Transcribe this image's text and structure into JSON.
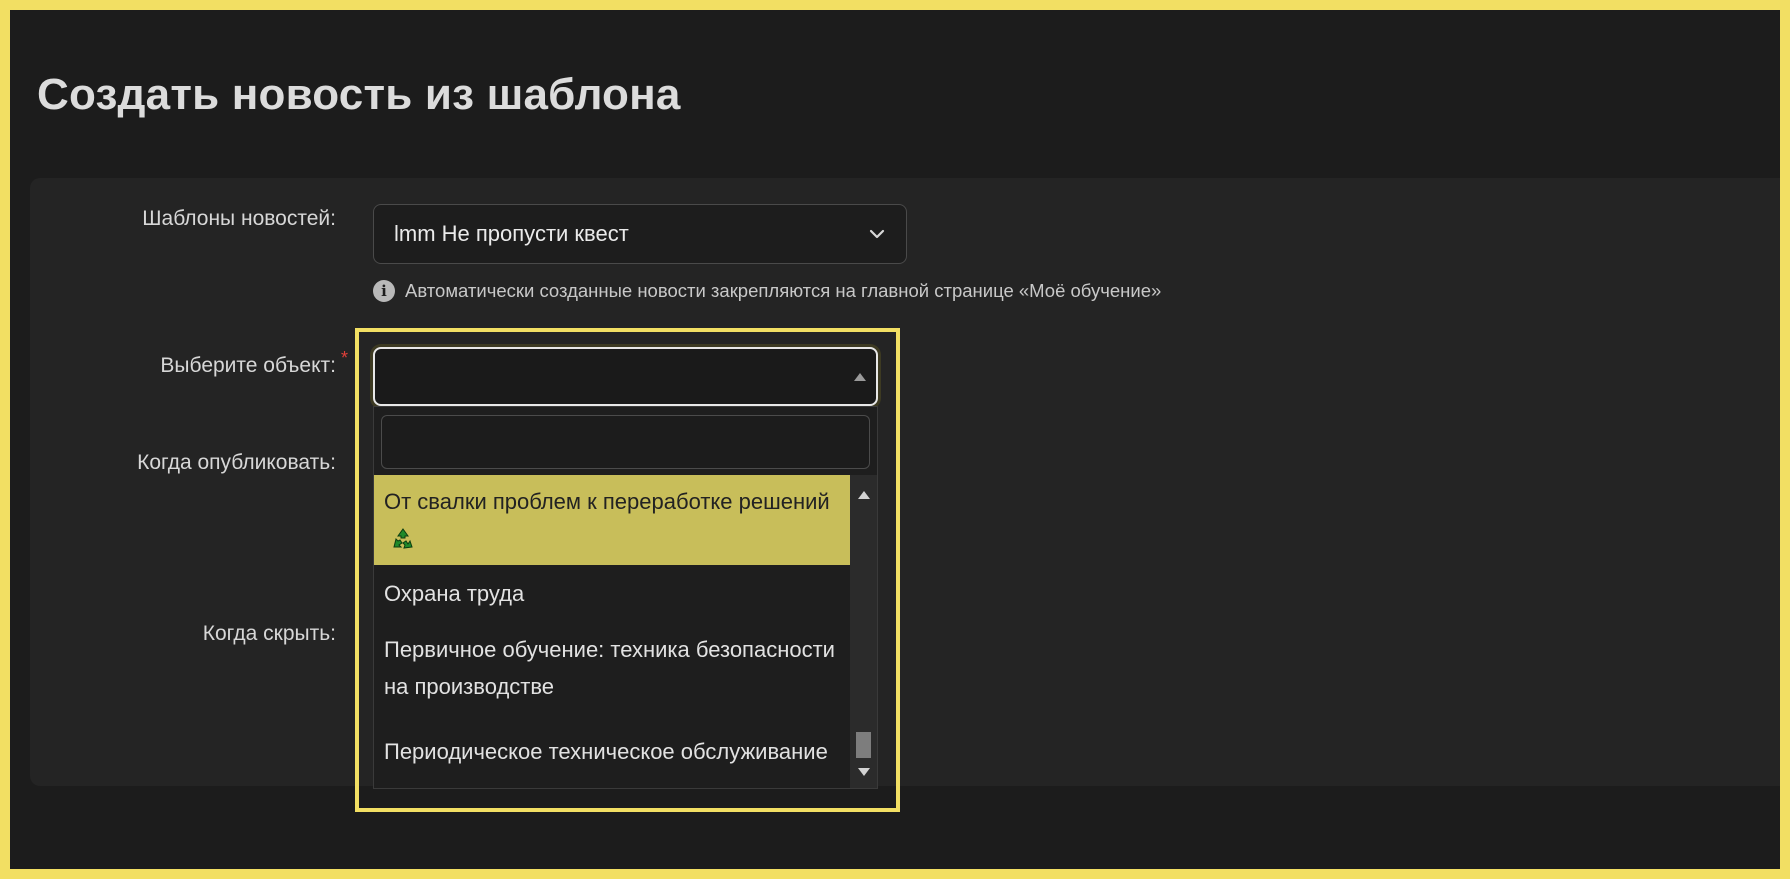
{
  "page": {
    "title": "Создать новость из шаблона"
  },
  "form": {
    "templates_label": "Шаблоны новостей:",
    "templates_value": "lmm Не пропусти квест",
    "hint": "Автоматически созданные новости закрепляются на главной странице «Моё обучение»",
    "object_label": "Выберите объект:",
    "object_required_mark": "*",
    "publish_label": "Когда опубликовать:",
    "hide_label": "Когда скрыть:"
  },
  "dropdown": {
    "search_value": "",
    "items": [
      {
        "label": "От свалки проблем к переработке решений",
        "icon": "recycle-icon",
        "highlighted": true
      },
      {
        "label": "Охрана труда",
        "highlighted": false
      },
      {
        "label": "Первичное обучение: техника безопасности на производстве",
        "highlighted": false
      },
      {
        "label": "Периодическое техническое обслуживание",
        "highlighted": false
      }
    ]
  },
  "colors": {
    "highlight_border": "#f2df63",
    "active_item": "#c8be5a",
    "required": "#e0403a"
  }
}
